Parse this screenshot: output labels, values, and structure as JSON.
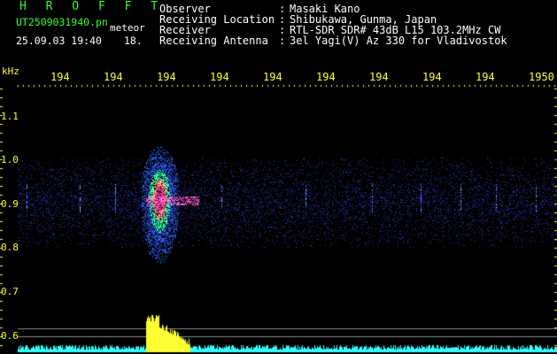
{
  "header": {
    "title": "H R O F F T",
    "filename": "UT2509031940.pn",
    "type_label": "meteor",
    "datetime": "25.09.03 19:40",
    "count": "18."
  },
  "info": [
    {
      "label": "Observer",
      "value": "Masaki Kano"
    },
    {
      "label": "Receiving Location",
      "value": "Shibukawa, Gunma, Japan"
    },
    {
      "label": "Receiver",
      "value": "RTL-SDR SDR# 43dB L15 103.2MHz CW"
    },
    {
      "label": "Receiving Antenna",
      "value": "3el Yagi(V) Az 330 for Vladivostok"
    }
  ],
  "y_axis": {
    "unit": "kHz",
    "ticks": [
      "1.1",
      "1.0",
      "0.9",
      "0.8",
      "0.7",
      "0.6"
    ]
  },
  "x_axis": {
    "ticks": [
      "194",
      "194",
      "194",
      "194",
      "194",
      "194",
      "194",
      "194",
      "194",
      "1950"
    ]
  },
  "colors": {
    "text_header": "#33ff33",
    "text_info": "#ffffff",
    "axis_labels": "#ffff33",
    "background": "#000000",
    "noise_band": "#1a2a9a",
    "meteor_core": "#ff3399",
    "level_trace_yellow": "#ffff33",
    "level_trace_cyan": "#33ffff"
  }
}
